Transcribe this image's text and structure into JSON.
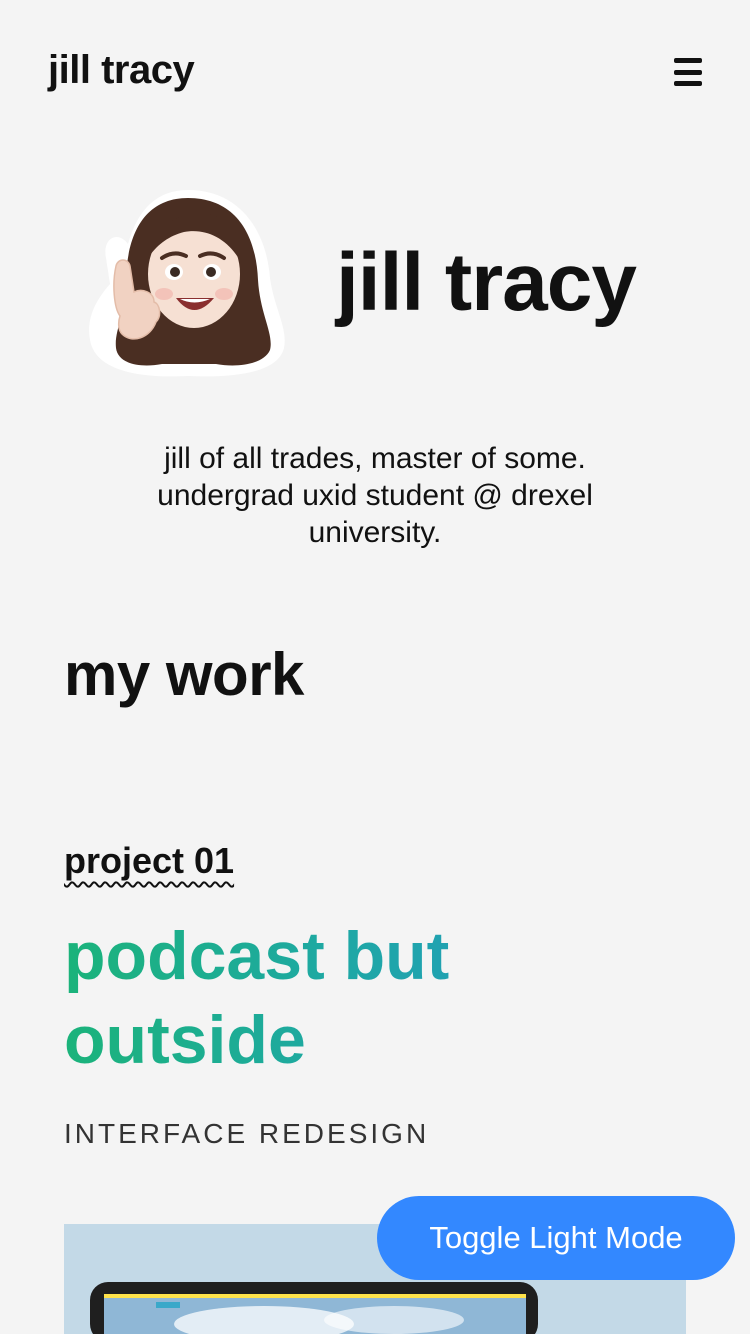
{
  "header": {
    "brand": "jill tracy",
    "menu_icon": "hamburger-icon"
  },
  "hero": {
    "avatar_icon": "memoji-avatar",
    "name": "jill tracy",
    "tagline": "jill of all trades, master of some. undergrad uxid student @ drexel university."
  },
  "work": {
    "title": "my work",
    "projects": [
      {
        "number": "project 01",
        "title": "podcast but outside",
        "type": "INTERFACE REDESIGN",
        "gradient": [
          "#1bb37a",
          "#2597c9"
        ]
      }
    ]
  },
  "toggle": {
    "label": "Toggle Light Mode",
    "color": "#3388ff"
  },
  "colors": {
    "background": "#f4f4f4",
    "text": "#111111"
  }
}
